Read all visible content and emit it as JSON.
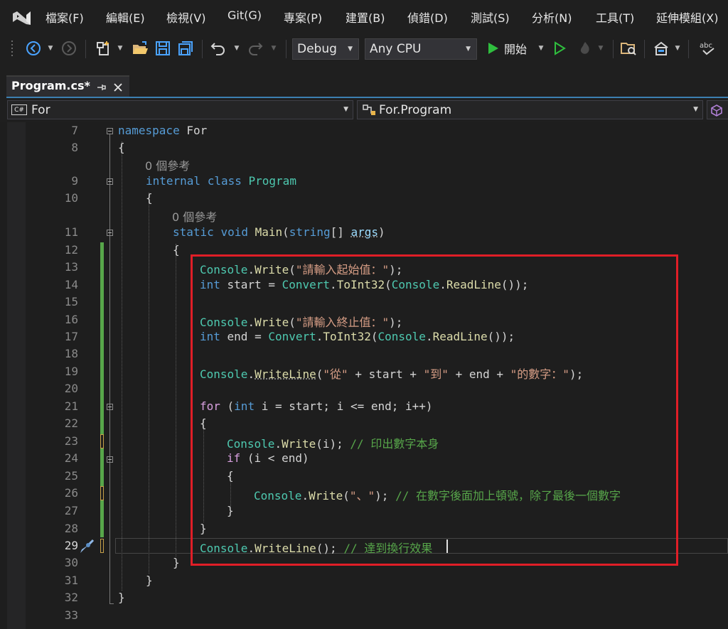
{
  "menubar": {
    "items": [
      "檔案(F)",
      "編輯(E)",
      "檢視(V)",
      "Git(G)",
      "專案(P)",
      "建置(B)",
      "偵錯(D)",
      "測試(S)",
      "分析(N)",
      "工具(T)",
      "延伸模組(X)"
    ]
  },
  "toolbar": {
    "config": "Debug",
    "platform": "Any CPU",
    "start_label": "開始",
    "icons": [
      "back-icon",
      "forward-icon",
      "new-project-icon",
      "open-icon",
      "save-icon",
      "save-all-icon",
      "undo-icon",
      "redo-icon",
      "start-icon",
      "start-without-debugging-icon",
      "hot-reload-icon",
      "solution-explorer-icon",
      "layout-icon",
      "spell-check-icon"
    ]
  },
  "tab": {
    "title": "Program.cs*"
  },
  "navbar": {
    "project_badge": "C#",
    "project": "For",
    "type": "For.Program"
  },
  "colors": {
    "background": "#1e1e1e",
    "keyword": "#569cd6",
    "control_keyword": "#d8a0df",
    "type": "#4ec9b0",
    "method": "#dcdcaa",
    "string": "#d69d85",
    "comment": "#57a64a",
    "highlight_box": "#e01e27"
  },
  "editor": {
    "line_numbers": [
      "7",
      "8",
      "9",
      "10",
      "11",
      "12",
      "13",
      "14",
      "15",
      "16",
      "17",
      "18",
      "19",
      "20",
      "21",
      "22",
      "23",
      "24",
      "25",
      "26",
      "27",
      "28",
      "29",
      "30",
      "31",
      "32",
      "33"
    ],
    "current_line": "29",
    "references": [
      "0 個參考",
      "0 個參考"
    ],
    "lines": {
      "l7": [
        "namespace",
        " For"
      ],
      "l8": [
        "{"
      ],
      "l9": [
        "internal",
        " ",
        "class",
        " ",
        "Program"
      ],
      "l10": [
        "{"
      ],
      "l11": [
        "static",
        " ",
        "void",
        " ",
        "Main",
        "(",
        "string",
        "[] ",
        "args",
        ")"
      ],
      "l12": [
        "{"
      ],
      "l13": [
        "Console",
        ".",
        "Write",
        "(",
        "\"請輸入起始值：\"",
        ");"
      ],
      "l14": [
        "int",
        " start = ",
        "Convert",
        ".",
        "ToInt32",
        "(",
        "Console",
        ".",
        "ReadLine",
        "());"
      ],
      "l16": [
        "Console",
        ".",
        "Write",
        "(",
        "\"請輸入終止值：\"",
        ");"
      ],
      "l17": [
        "int",
        " end = ",
        "Convert",
        ".",
        "ToInt32",
        "(",
        "Console",
        ".",
        "ReadLine",
        "());"
      ],
      "l19": [
        "Console",
        ".",
        "WriteLine",
        "(",
        "\"從\"",
        " + start + ",
        "\"到\"",
        " + end + ",
        "\"的數字：\"",
        ");"
      ],
      "l21": [
        "for",
        " (",
        "int",
        " i = start; i <= end; i++)"
      ],
      "l22": [
        "{"
      ],
      "l23": [
        "Console",
        ".",
        "Write",
        "(i); ",
        "// 印出數字本身"
      ],
      "l24": [
        "if",
        " (i < end)"
      ],
      "l25": [
        "{"
      ],
      "l26": [
        "Console",
        ".",
        "Write",
        "(",
        "\"、\"",
        "); ",
        "// 在數字後面加上頓號，除了最後一個數字"
      ],
      "l27": [
        "}"
      ],
      "l28": [
        "}"
      ],
      "l29": [
        "Console",
        ".",
        "WriteLine",
        "(); ",
        "// 達到換行效果"
      ],
      "l30": [
        "}"
      ],
      "l31": [
        "}"
      ],
      "l32": [
        "}"
      ]
    }
  }
}
